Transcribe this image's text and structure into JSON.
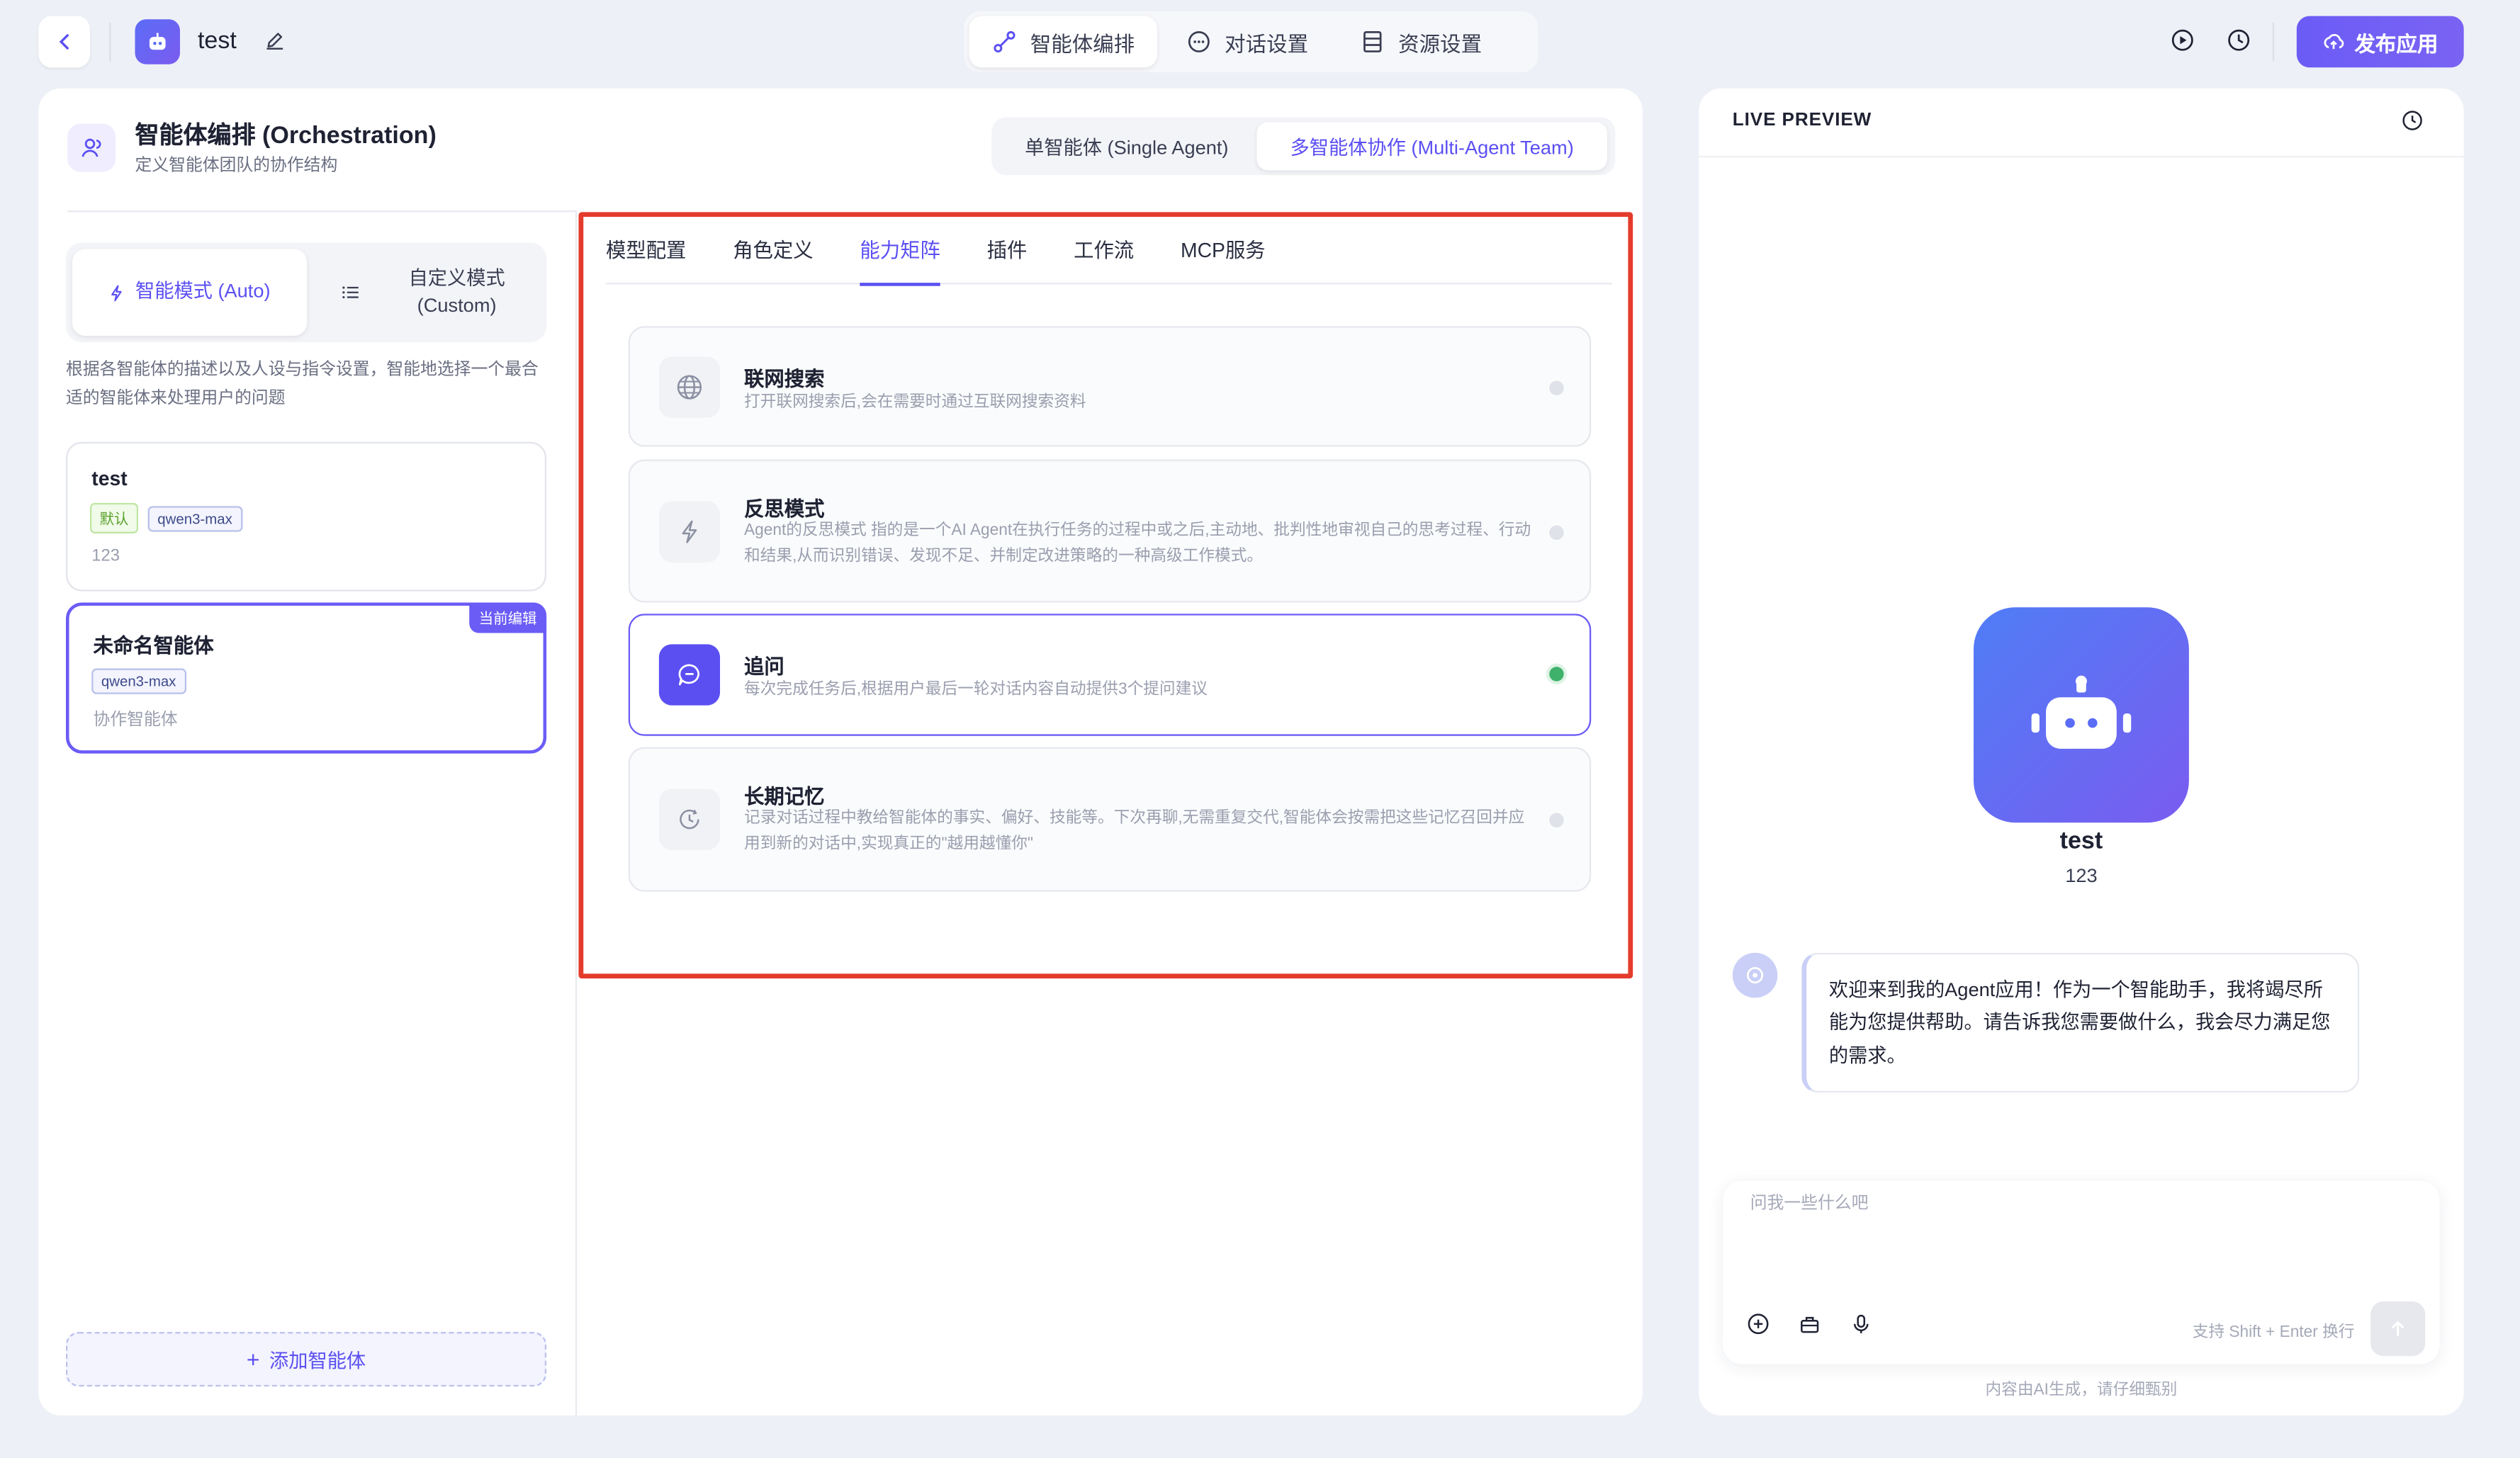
{
  "header": {
    "app_name": "test",
    "tabs": [
      {
        "label": "智能体编排",
        "icon": "orchestration-icon",
        "active": true
      },
      {
        "label": "对话设置",
        "icon": "chat-icon",
        "active": false
      },
      {
        "label": "资源设置",
        "icon": "resource-icon",
        "active": false
      }
    ],
    "publish_label": "发布应用"
  },
  "orchestration": {
    "title": "智能体编排 (Orchestration)",
    "subtitle": "定义智能体团队的协作结构",
    "modes": [
      {
        "label": "单智能体 (Single Agent)",
        "active": false
      },
      {
        "label": "多智能体协作 (Multi-Agent Team)",
        "active": true
      }
    ]
  },
  "team": {
    "auto_label": "智能模式 (Auto)",
    "custom_label": "自定义模式\n(Custom)",
    "description": "根据各智能体的描述以及人设与指令设置，智能地选择一个最合适的智能体来处理用户的问题",
    "agents": [
      {
        "name": "test",
        "tags": [
          "默认",
          "qwen3-max"
        ],
        "desc": "123",
        "current": false
      },
      {
        "name": "未命名智能体",
        "tags": [
          "qwen3-max"
        ],
        "desc": "协作智能体",
        "current": true,
        "badge": "当前编辑"
      }
    ],
    "add_label": "添加智能体"
  },
  "capability": {
    "tabs": [
      "模型配置",
      "角色定义",
      "能力矩阵",
      "插件",
      "工作流",
      "MCP服务"
    ],
    "active_tab": "能力矩阵",
    "items": [
      {
        "name": "联网搜索",
        "desc": "打开联网搜索后,会在需要时通过互联网搜索资料",
        "icon": "globe-icon",
        "enabled": false
      },
      {
        "name": "反思模式",
        "desc": "Agent的反思模式 指的是一个AI Agent在执行任务的过程中或之后,主动地、批判性地审视自己的思考过程、行动和结果,从而识别错误、发现不足、并制定改进策略的一种高级工作模式。",
        "icon": "lightning-icon",
        "enabled": false
      },
      {
        "name": "追问",
        "desc": "每次完成任务后,根据用户最后一轮对话内容自动提供3个提问建议",
        "icon": "chat-bubble-icon",
        "enabled": true
      },
      {
        "name": "长期记忆",
        "desc": "记录对话过程中教给智能体的事实、偏好、技能等。下次再聊,无需重复交代,智能体会按需把这些记忆召回并应用到新的对话中,实现真正的\"越用越懂你\"",
        "icon": "clock-memory-icon",
        "enabled": false
      }
    ]
  },
  "preview": {
    "title": "LIVE PREVIEW",
    "bot_name": "test",
    "bot_desc": "123",
    "welcome": "欢迎来到我的Agent应用！作为一个智能助手，我将竭尽所能为您提供帮助。请告诉我您需要做什么，我会尽力满足您的需求。",
    "input_placeholder": "问我一些什么吧",
    "input_hint": "支持 Shift + Enter 换行",
    "disclaimer": "内容由AI生成，请仔细甄别"
  },
  "colors": {
    "accent": "#5b4ff2",
    "highlight_border": "#e43b2c",
    "enabled_dot": "#3fb16a"
  }
}
